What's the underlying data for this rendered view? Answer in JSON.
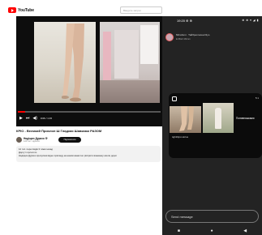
{
  "youtube": {
    "logo_text": "YouTube",
    "search_placeholder": "Введите запрос",
    "video": {
      "progress_fraction": 0.05,
      "time": "0:06 / 1:15"
    },
    "title": "КРIO - Великий Прихлоп Ш Гладкая Шавками РАЗОМ",
    "channel": {
      "name": "Надiщин Дурахо Ф",
      "subscribers": "120 тис. пiдписн.",
      "subscribe_label": "Пiдписатися"
    },
    "description": [
      "12 тис. переглядiв  3 тижнi назад",
      "Доргут горсосото",
      "Надiщин Дурахо пропуская вiдео прiкладу на нашiм каналi ко рiсприти взаемеку нiшли дорог"
    ]
  },
  "phone": {
    "status": {
      "time": "19:20 ⊕ ⊕",
      "icons": "⊕ ⊕ ▾ ◢ ▮"
    },
    "story": {
      "user": "Mirrahoni · Тайбрегласеа Diyo",
      "sub": "Ei Bleh Mirran"
    },
    "shared_post": {
      "time": "5:1",
      "caption": "Попивняшками",
      "author": "tightDjronutrius"
    },
    "message_placeholder": "Send message",
    "nav": [
      "■",
      "●",
      "◀"
    ]
  }
}
